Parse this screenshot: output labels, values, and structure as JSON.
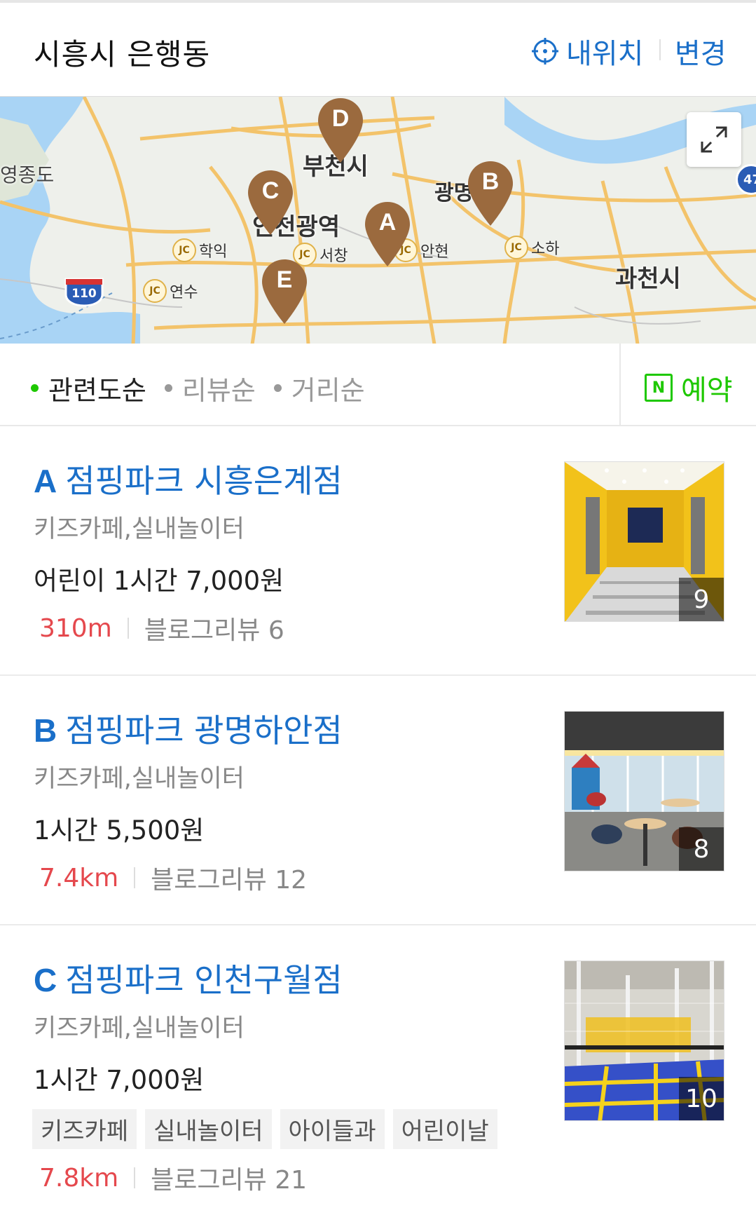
{
  "header": {
    "location": "시흥시 은행동",
    "my_location": "내위치",
    "change": "변경"
  },
  "map": {
    "labels": {
      "yeongjong": "영종도",
      "bucheon": "부천시",
      "incheon": "인천광역",
      "gwangmyeong": "광명",
      "gwacheon": "과천시"
    },
    "jc": [
      "학익",
      "서창",
      "안현",
      "소하",
      "연수"
    ],
    "jc_badge": "JC",
    "highway": "110",
    "highway_right": "47",
    "pins": [
      "A",
      "B",
      "C",
      "D",
      "E"
    ],
    "pin_color": "#9b6a3e",
    "expand_icon": "expand-icon"
  },
  "sort": {
    "options": [
      "관련도순",
      "리뷰순",
      "거리순"
    ],
    "active": "관련도순",
    "booking": "예약",
    "booking_icon": "N"
  },
  "results": [
    {
      "letter": "A",
      "name": "점핑파크 시흥은계점",
      "category": "키즈카페,실내놀이터",
      "price": "어린이 1시간 7,000원",
      "distance": "310m",
      "reviews": "블로그리뷰 6",
      "photo_count": "9",
      "tags": []
    },
    {
      "letter": "B",
      "name": "점핑파크 광명하안점",
      "category": "키즈카페,실내놀이터",
      "price": "1시간 5,500원",
      "distance": "7.4km",
      "reviews": "블로그리뷰 12",
      "photo_count": "8",
      "tags": []
    },
    {
      "letter": "C",
      "name": "점핑파크 인천구월점",
      "category": "키즈카페,실내놀이터",
      "price": "1시간 7,000원",
      "distance": "7.8km",
      "reviews": "블로그리뷰 21",
      "photo_count": "10",
      "tags": [
        "키즈카페",
        "실내놀이터",
        "아이들과",
        "어린이날"
      ]
    }
  ],
  "colors": {
    "accent_blue": "#1a6fc9",
    "naver_green": "#1ec800",
    "distance_red": "#e5484d"
  }
}
